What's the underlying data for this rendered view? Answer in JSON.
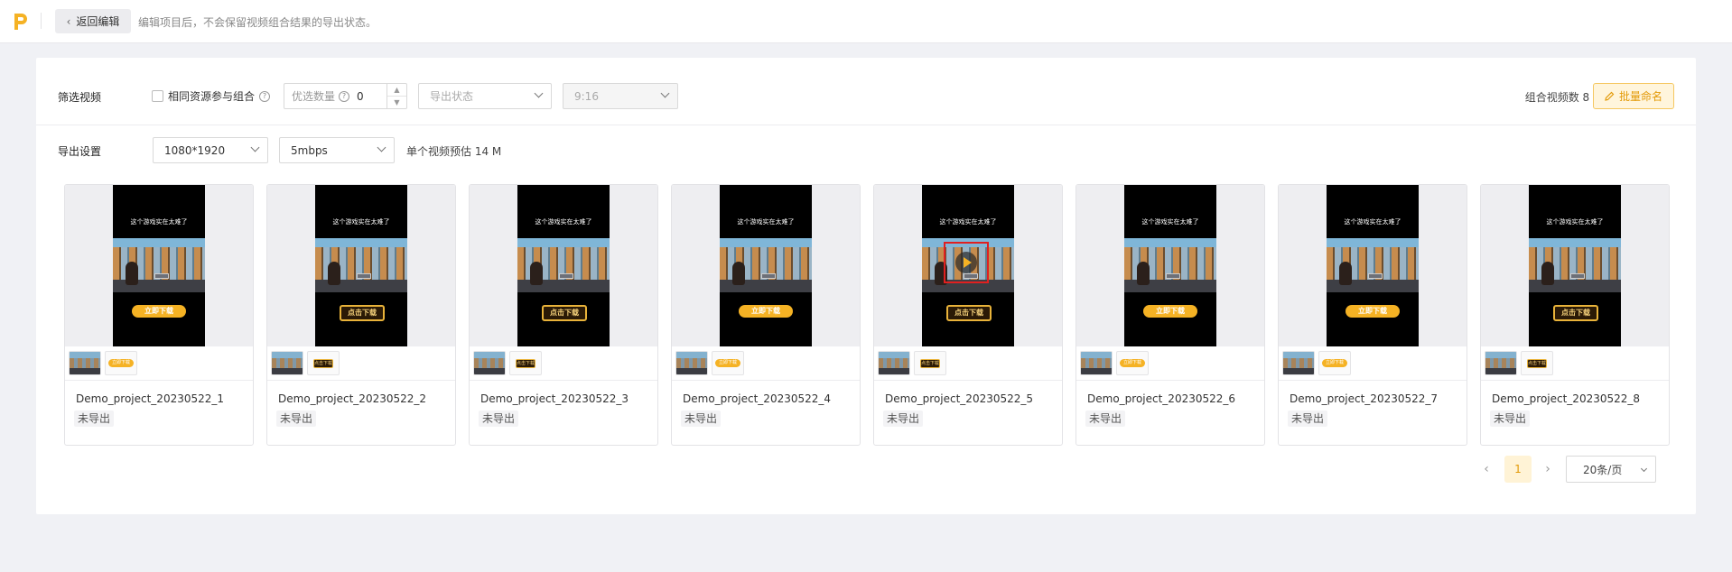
{
  "topbar": {
    "logo_icon": "pi-logo-icon",
    "back_label": "返回编辑",
    "hint": "编辑项目后，不会保留视频组合结果的导出状态。"
  },
  "filter": {
    "label": "筛选视频",
    "same_source_label": "相同资源参与组合",
    "priority_placeholder": "优选数量",
    "priority_value": "0",
    "export_status_placeholder": "导出状态",
    "ratio_value": "9:16",
    "combo_count": "组合视频数 8 个",
    "batch_rename_label": "批量命名"
  },
  "export_settings": {
    "label": "导出设置",
    "resolution": "1080*1920",
    "bitrate": "5mbps",
    "estimate": "单个视频预估 14 M"
  },
  "video_caption": "这个游戏实在太难了",
  "cards": [
    {
      "name": "Demo_project_20230522_1",
      "status": "未导出",
      "cta_style": "pill",
      "cta_text": "立即下载",
      "thumb_text": "立即下载"
    },
    {
      "name": "Demo_project_20230522_2",
      "status": "未导出",
      "cta_style": "box",
      "cta_text": "点击下载",
      "thumb_text": "点击下载"
    },
    {
      "name": "Demo_project_20230522_3",
      "status": "未导出",
      "cta_style": "box",
      "cta_text": "点击下载",
      "thumb_text": "点击下载"
    },
    {
      "name": "Demo_project_20230522_4",
      "status": "未导出",
      "cta_style": "pill",
      "cta_text": "立即下载",
      "thumb_text": "立即下载"
    },
    {
      "name": "Demo_project_20230522_5",
      "status": "未导出",
      "cta_style": "box",
      "cta_text": "点击下载",
      "thumb_text": "点击下载"
    },
    {
      "name": "Demo_project_20230522_6",
      "status": "未导出",
      "cta_style": "pill",
      "cta_text": "立即下载",
      "thumb_text": "立即下载"
    },
    {
      "name": "Demo_project_20230522_7",
      "status": "未导出",
      "cta_style": "pill",
      "cta_text": "立即下载",
      "thumb_text": "立即下载"
    },
    {
      "name": "Demo_project_20230522_8",
      "status": "未导出",
      "cta_style": "box",
      "cta_text": "点击下载",
      "thumb_text": "点击下载"
    }
  ],
  "pagination": {
    "current_page": "1",
    "page_size": "20条/页"
  },
  "colors": {
    "accent": "#f5b224",
    "accent_text": "#e39a08",
    "highlight_border": "#e02020"
  }
}
